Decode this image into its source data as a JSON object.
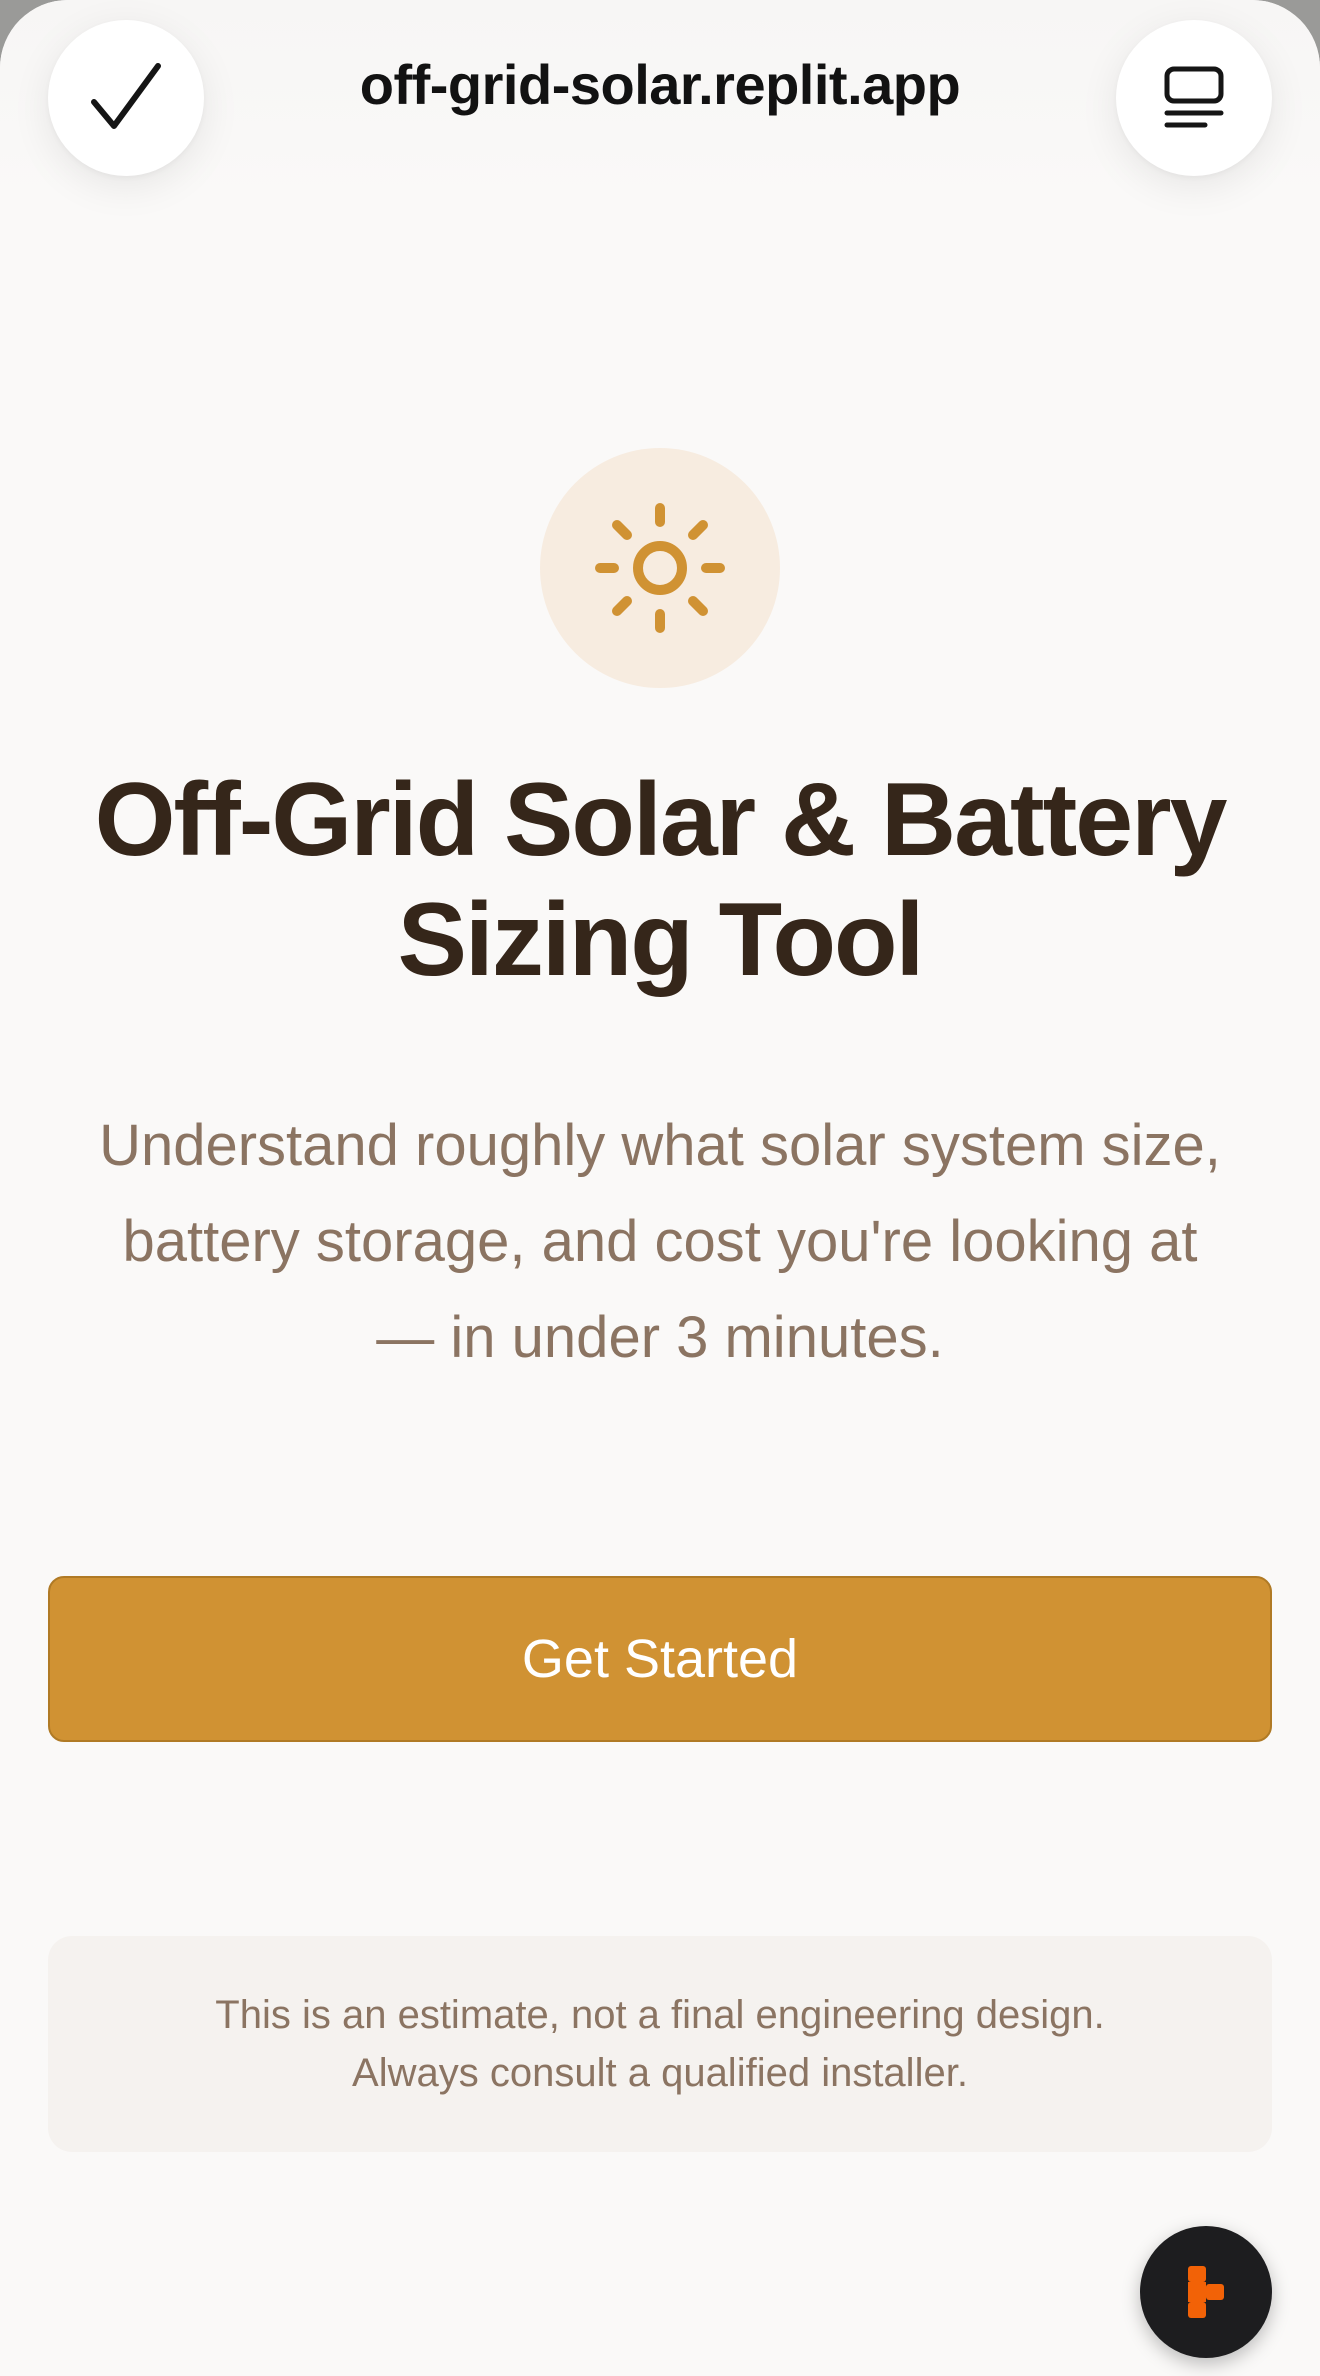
{
  "browser": {
    "url": "off-grid-solar.replit.app",
    "left_icon": "checkmark-icon",
    "right_icon": "tabs-icon"
  },
  "hero": {
    "icon": "sun-icon",
    "title_line1": "Off-Grid Solar & Battery",
    "title_line2": "Sizing Tool",
    "subtitle": "Understand roughly what solar system size, battery storage, and cost you're looking at — in under 3 minutes."
  },
  "cta": {
    "label": "Get Started"
  },
  "disclaimer": {
    "line1": "This is an estimate, not a final engineering design.",
    "line2": "Always consult a qualified installer."
  },
  "fab": {
    "icon": "replit-logo-icon"
  },
  "colors": {
    "accent": "#d09233",
    "accent_border": "#b07a25",
    "title": "#35261a",
    "muted_text": "#8b7462",
    "icon_bg": "#f7ece0",
    "background": "#faf9f8",
    "notice_bg": "#f5f2ef",
    "replit_orange": "#f26207"
  }
}
